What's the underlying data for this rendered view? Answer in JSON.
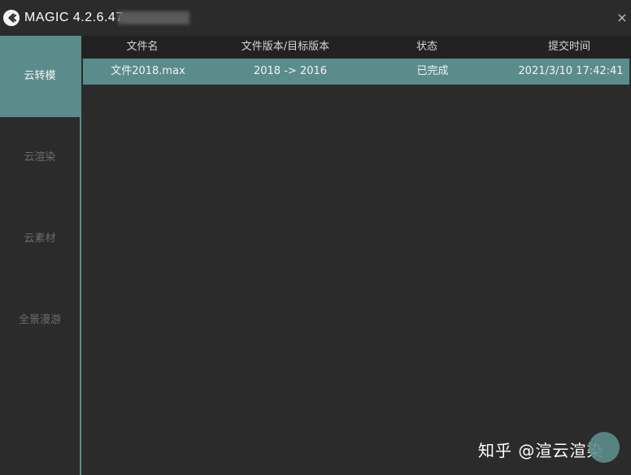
{
  "window": {
    "title": "MAGIC 4.2.6.47",
    "close_glyph": "×"
  },
  "sidebar": {
    "items": [
      {
        "label": "云转模",
        "active": true
      },
      {
        "label": "云渲染",
        "active": false
      },
      {
        "label": "云素材",
        "active": false
      },
      {
        "label": "全景漫游",
        "active": false
      }
    ]
  },
  "table": {
    "headers": [
      "文件名",
      "文件版本/目标版本",
      "状态",
      "提交时间"
    ],
    "rows": [
      [
        "文件2018.max",
        "2018 -> 2016",
        "已完成",
        "2021/3/10 17:42:41"
      ]
    ]
  },
  "watermark": "知乎 @渲云渲染",
  "colors": {
    "accent": "#5b8c8c",
    "background": "#2b2b2b",
    "header": "#222222"
  }
}
